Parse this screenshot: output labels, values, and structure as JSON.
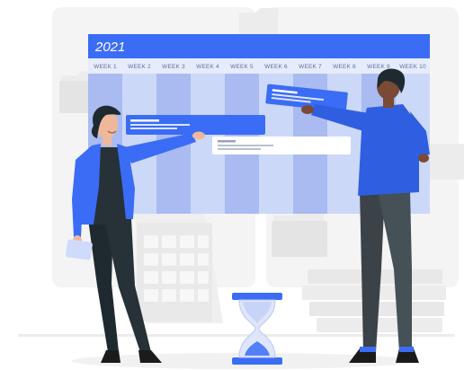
{
  "board": {
    "year": "2021",
    "weeks": [
      "WEEK 1",
      "WEEK 2",
      "WEEK 3",
      "WEEK 4",
      "WEEK 5",
      "WEEK 6",
      "WEEK 7",
      "WEEK 8",
      "WEEK 9",
      "WEEK 10"
    ]
  },
  "colors": {
    "accent": "#3b6cf6",
    "board_header": "#3b6cf6",
    "week_row": "#e6ecfb",
    "column_dark": "#a9bbf0",
    "column_light": "#ccd8f8",
    "card_blue": "#3b6cf6",
    "card_white": "#ffffff",
    "figure_dark": "#263238",
    "shirt_blue": "#3b6cf6",
    "background_gray": "#f3f3f3"
  },
  "icons": [
    "hourglass-icon",
    "folder-icon",
    "calendar-icon"
  ]
}
